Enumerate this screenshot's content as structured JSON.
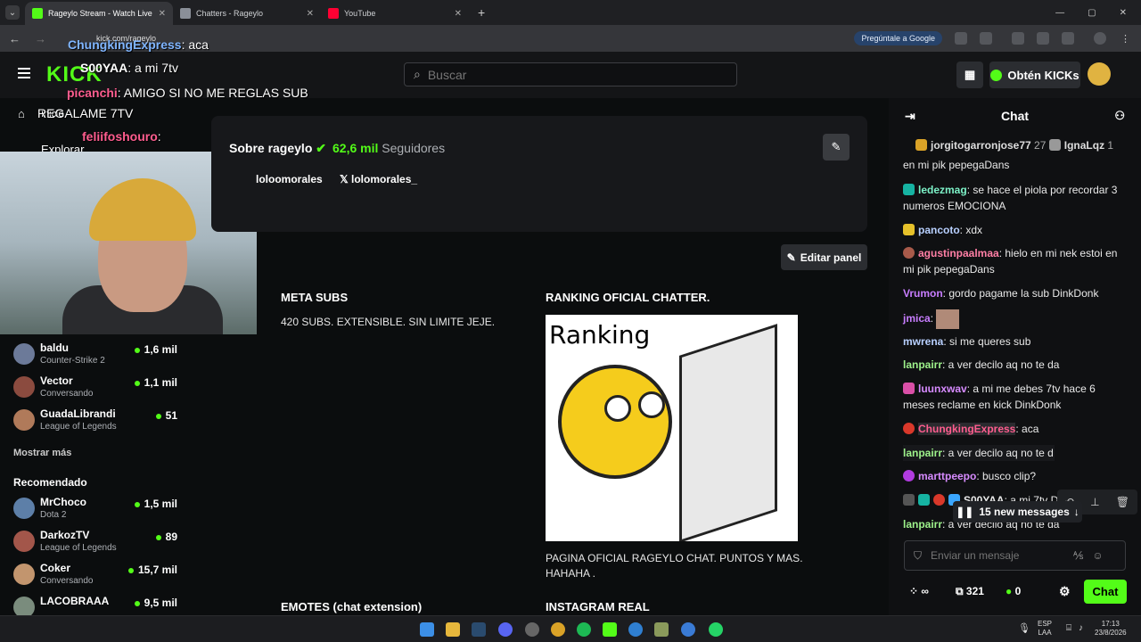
{
  "browser": {
    "tabs": [
      {
        "label": "Rageylo Stream - Watch Live on",
        "active": true,
        "favicon_color": "#53fc18"
      },
      {
        "label": "Chatters - Rageylo",
        "active": false,
        "favicon_color": "#8a8f98"
      },
      {
        "label": "YouTube",
        "active": false,
        "favicon_color": "#ff0033"
      }
    ],
    "url": "kick.com/rageylo",
    "ask_google": "Pregúntale a Google"
  },
  "header": {
    "logo": "KICK",
    "search_placeholder": "Buscar",
    "get_kicks": "Obtén KICKs"
  },
  "overlay_chat": [
    {
      "user": "ChungkingExpress",
      "text": ": aca"
    },
    {
      "user": "S00YAA",
      "text": ": a mi 7tv"
    },
    {
      "user": "picanchi",
      "text": ": AMIGO SI NO ME REGLAS SUB"
    },
    {
      "user": "",
      "text": "REGALAME 7TV"
    },
    {
      "user": "feliifoshouro",
      "text": ":"
    }
  ],
  "sidebar": {
    "home": "Inicio",
    "explore": "Explorar",
    "following": [
      {
        "name": "baldu",
        "game": "Counter-Strike 2",
        "viewers": "1,6 mil"
      },
      {
        "name": "Vector",
        "game": "Conversando",
        "viewers": "1,1 mil"
      },
      {
        "name": "GuadaLibrandi",
        "game": "League of Legends",
        "viewers": "51"
      }
    ],
    "show_more": "Mostrar más",
    "recommended_title": "Recomendado",
    "recommended": [
      {
        "name": "MrChoco",
        "game": "Dota 2",
        "viewers": "1,5 mil"
      },
      {
        "name": "DarkozTV",
        "game": "League of Legends",
        "viewers": "89"
      },
      {
        "name": "Coker",
        "game": "Conversando",
        "viewers": "15,7 mil"
      },
      {
        "name": "LACOBRAAA",
        "game": "",
        "viewers": "9,5 mil"
      }
    ]
  },
  "about": {
    "title": "Sobre rageylo",
    "followers": "62,6 mil",
    "followers_label": "Seguidores",
    "social_1": "loloomorales",
    "social_2": "lolomorales_",
    "edit_panel": "Editar panel"
  },
  "panels": {
    "meta_title": "META SUBS",
    "meta_text": "420 SUBS. EXTENSIBLE. SIN LIMITE JEJE.",
    "ranking_title": "RANKING OFICIAL CHATTER.",
    "ranking_image_text": "Ranking",
    "ranking_text_1": "PAGINA OFICIAL RAGEYLO CHAT. PUNTOS Y MAS.",
    "ranking_text_2": "HAHAHA .",
    "emotes_title": "EMOTES (chat extension)",
    "instagram_title": "INSTAGRAM REAL"
  },
  "chat": {
    "title": "Chat",
    "gifter_1": "jorgitogarronjose77",
    "gifter_1_count": "27",
    "gifter_2": "IgnaLqz",
    "gifter_2_count": "1",
    "messages": [
      {
        "user": "",
        "text": "en mi pik pepegaDans",
        "color": "#e9e9e9"
      },
      {
        "user": "ledezmag",
        "text": ": se hace el piola por recordar 3 numeros EMOCIONA",
        "color": "#7df2c8"
      },
      {
        "user": "pancoto",
        "text": ": xdx",
        "color": "#b8d0ff"
      },
      {
        "user": "agustinpaalmaa",
        "text": ": hielo en mi nek estoi en mi pik pepegaDans",
        "color": "#ff7fa5"
      },
      {
        "user": "Vrumon",
        "text": ": gordo pagame la sub DinkDonk",
        "color": "#c87dff"
      },
      {
        "user": "jmica",
        "text": ":",
        "color": "#c87dff"
      },
      {
        "user": "mwrena",
        "text": ": si me queres sub",
        "color": "#b8d0ff"
      },
      {
        "user": "lanpairr",
        "text": ": a ver decilo aq no te da",
        "color": "#9ef28b"
      },
      {
        "user": "luunxwav",
        "text": ": a mi me debes 7tv hace 6 meses reclame en kick DinkDonk",
        "color": "#d78bff"
      },
      {
        "user": "ChungkingExpress",
        "text": ": aca",
        "color": "#ff5d8f"
      },
      {
        "user": "lanpairr",
        "text": ": a ver decilo aq no te d",
        "color": "#9ef28b"
      },
      {
        "user": "marttpeepo",
        "text": ": busco clip?",
        "color": "#d78bff"
      },
      {
        "user": "S00YAA",
        "text": ": a mi 7tv DinkDonk",
        "color": "#e9e9e9"
      },
      {
        "user": "lanpairr",
        "text": ": a ver decilo aq no te da",
        "color": "#9ef28b"
      }
    ],
    "new_messages": "15 new messages",
    "input_placeholder": "Enviar un mensaje",
    "points": "321",
    "kicks": "0",
    "send": "Chat"
  },
  "taskbar": {
    "lang_1": "ESP",
    "lang_2": "LAA",
    "time": "17:13",
    "date": "23/8/2026"
  }
}
